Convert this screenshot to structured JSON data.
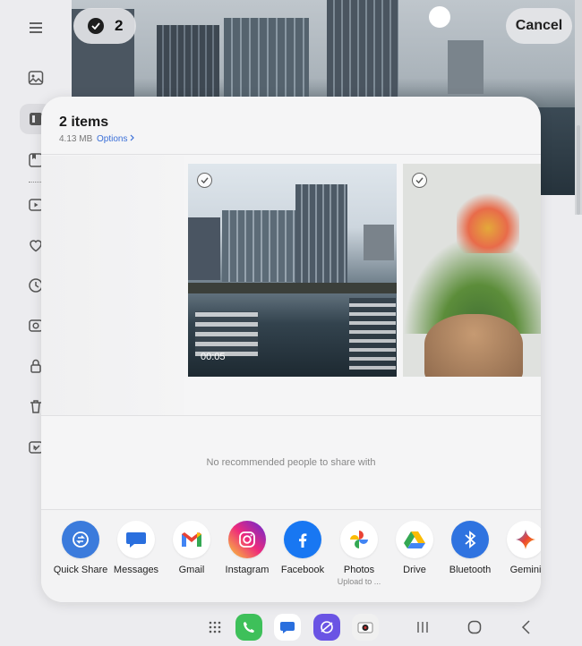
{
  "header": {
    "selected_count": "2",
    "cancel_label": "Cancel"
  },
  "rail": {
    "items": [
      "menu-icon",
      "pictures-icon",
      "albums-icon",
      "stories-icon",
      "videos-icon",
      "favorites-icon",
      "recent-icon",
      "camera-icon",
      "secure-folder-icon",
      "trash-icon",
      "edit-icon"
    ]
  },
  "share_sheet": {
    "title": "2 items",
    "size": "4.13 MB",
    "options_label": "Options",
    "video_duration": "00:05",
    "no_people_text": "No recommended people to share with",
    "apps": [
      {
        "label": "Quick Share",
        "sub": "",
        "icon": "quick-share-icon"
      },
      {
        "label": "Messages",
        "sub": "",
        "icon": "messages-icon"
      },
      {
        "label": "Gmail",
        "sub": "",
        "icon": "gmail-icon"
      },
      {
        "label": "Instagram",
        "sub": "",
        "icon": "instagram-icon"
      },
      {
        "label": "Facebook",
        "sub": "",
        "icon": "facebook-icon"
      },
      {
        "label": "Photos",
        "sub": "Upload to ...",
        "icon": "photos-icon"
      },
      {
        "label": "Drive",
        "sub": "",
        "icon": "drive-icon"
      },
      {
        "label": "Bluetooth",
        "sub": "",
        "icon": "bluetooth-icon"
      },
      {
        "label": "Gemini",
        "sub": "",
        "icon": "gemini-icon"
      }
    ]
  },
  "taskbar": {
    "apps": [
      "app-drawer-icon",
      "phone-icon",
      "messages-icon",
      "internet-icon",
      "camera-icon"
    ],
    "nav": [
      "recents-icon",
      "home-icon",
      "back-icon"
    ]
  },
  "colors": {
    "accent": "#3a6fd8",
    "sheet_bg": "#f5f5f6",
    "page_bg": "#ececef"
  }
}
